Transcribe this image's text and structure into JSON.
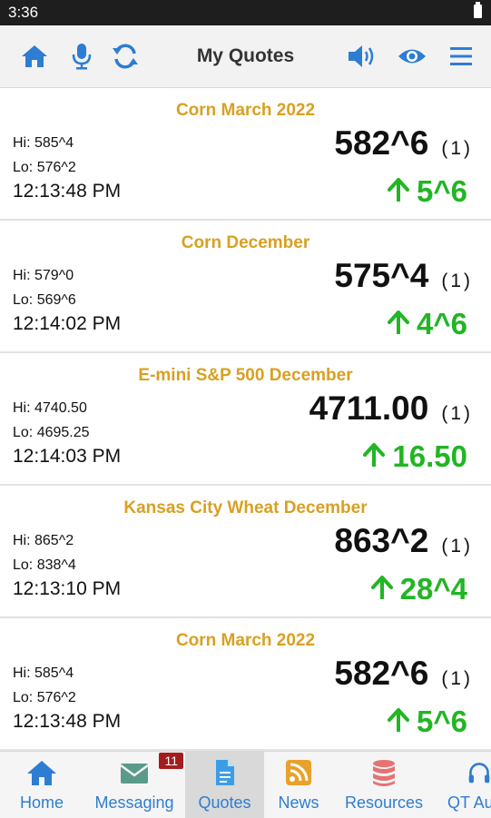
{
  "status_bar": {
    "time": "3:36"
  },
  "toolbar": {
    "title": "My Quotes"
  },
  "quotes": [
    {
      "name": "Corn March 2022",
      "hi": "Hi: 585^4",
      "lo": "Lo: 576^2",
      "time": "12:13:48 PM",
      "price": "582^6",
      "count": "(1)",
      "change": "5^6"
    },
    {
      "name": "Corn December",
      "hi": "Hi: 579^0",
      "lo": "Lo: 569^6",
      "time": "12:14:02 PM",
      "price": "575^4",
      "count": "(1)",
      "change": "4^6"
    },
    {
      "name": "E-mini S&P 500 December",
      "hi": "Hi: 4740.50",
      "lo": "Lo: 4695.25",
      "time": "12:14:03 PM",
      "price": "4711.00",
      "count": "(1)",
      "change": "16.50"
    },
    {
      "name": "Kansas City Wheat December",
      "hi": "Hi: 865^2",
      "lo": "Lo: 838^4",
      "time": "12:13:10 PM",
      "price": "863^2",
      "count": "(1)",
      "change": "28^4"
    },
    {
      "name": "Corn March 2022",
      "hi": "Hi: 585^4",
      "lo": "Lo: 576^2",
      "time": "12:13:48 PM",
      "price": "582^6",
      "count": "(1)",
      "change": "5^6"
    }
  ],
  "bottom_nav": {
    "home": "Home",
    "messaging": "Messaging",
    "messaging_badge": "11",
    "quotes": "Quotes",
    "news": "News",
    "resources": "Resources",
    "qt": "QT Au"
  },
  "colors": {
    "accent": "#2d7dd2",
    "name": "#d9a021",
    "up": "#22b524",
    "badge": "#a41d1d"
  }
}
